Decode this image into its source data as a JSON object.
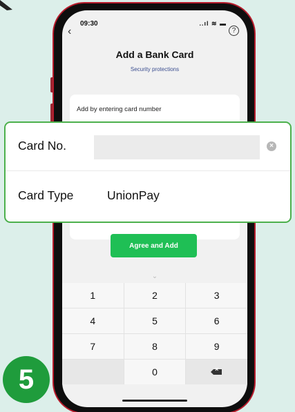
{
  "status_bar": {
    "time": "09:30",
    "icons": "..ıl ≋ ▬"
  },
  "header": {
    "back": "‹",
    "help": "?",
    "title": "Add a Bank Card",
    "subtitle": "Security protections"
  },
  "form": {
    "hint": "Add by entering card number",
    "agree_label": "Agree and Add"
  },
  "overlay": {
    "card_no_label": "Card No.",
    "card_no_value": "",
    "clear": "×",
    "card_type_label": "Card Type",
    "card_type_value": "UnionPay"
  },
  "keypad": {
    "chevron": "⌄",
    "keys": [
      "1",
      "2",
      "3",
      "4",
      "5",
      "6",
      "7",
      "8",
      "9",
      "",
      "0",
      "delete"
    ]
  },
  "step_badge": "5",
  "colors": {
    "accent_green": "#1fbf55",
    "phone_frame": "#b71c2c",
    "badge": "#1f9c3c",
    "highlight_border": "#4cb04c"
  }
}
